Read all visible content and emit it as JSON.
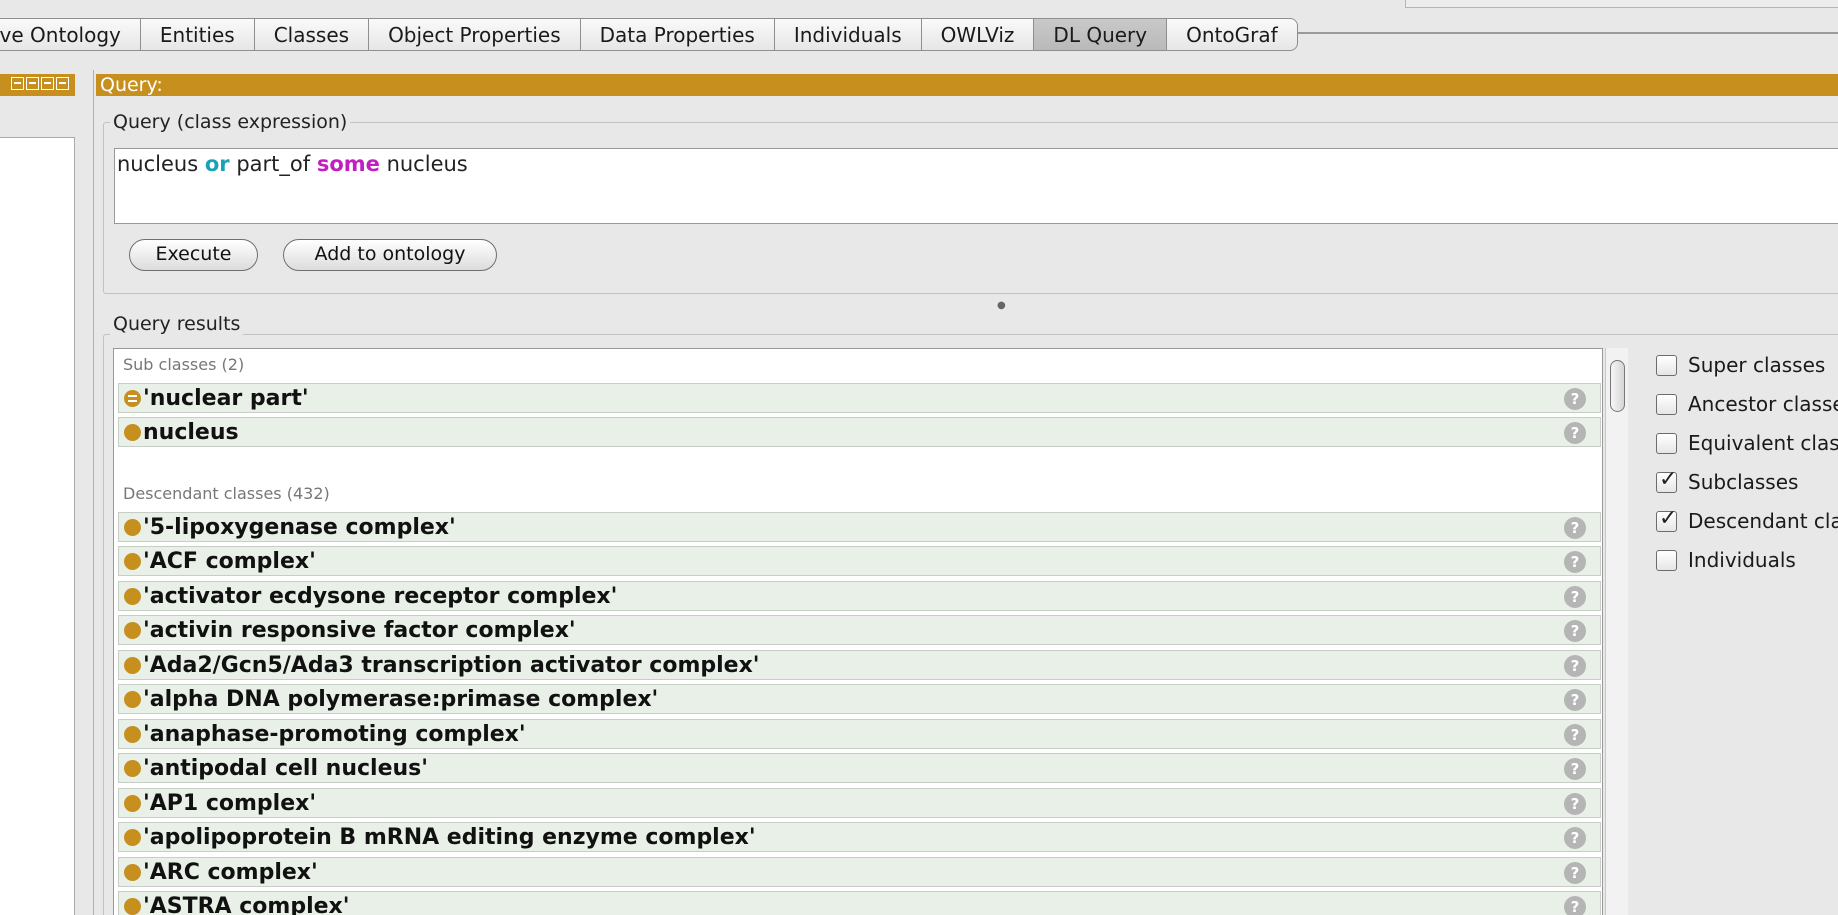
{
  "tabs": [
    {
      "label": "ive Ontology",
      "active": false
    },
    {
      "label": "Entities",
      "active": false
    },
    {
      "label": "Classes",
      "active": false
    },
    {
      "label": "Object Properties",
      "active": false
    },
    {
      "label": "Data Properties",
      "active": false
    },
    {
      "label": "Individuals",
      "active": false
    },
    {
      "label": "OWLViz",
      "active": false
    },
    {
      "label": "DL Query",
      "active": true
    },
    {
      "label": "OntoGraf",
      "active": false
    }
  ],
  "query_panel": {
    "header": "Query:",
    "expression_legend": "Query (class expression)",
    "expression": {
      "part1": "nucleus ",
      "kw1": "or",
      "part2": " part_of ",
      "kw2": "some",
      "part3": " nucleus"
    },
    "execute_label": "Execute",
    "add_label": "Add to ontology"
  },
  "results": {
    "legend": "Query results",
    "subclasses_label": "Sub classes (2)",
    "subclasses": [
      {
        "name": "'nuclear part'",
        "equivalent": true
      },
      {
        "name": "nucleus",
        "equivalent": false
      }
    ],
    "descendants_label": "Descendant classes (432)",
    "descendants": [
      "'5-lipoxygenase complex'",
      "'ACF complex'",
      "'activator ecdysone receptor complex'",
      "'activin responsive factor complex'",
      "'Ada2/Gcn5/Ada3 transcription activator complex'",
      "'alpha DNA polymerase:primase complex'",
      "'anaphase-promoting complex'",
      "'antipodal cell nucleus'",
      "'AP1 complex'",
      "'apolipoprotein B mRNA editing enzyme complex'",
      "'ARC complex'",
      "'ASTRA complex'"
    ],
    "help_glyph": "?"
  },
  "options": [
    {
      "label": "Super classes",
      "checked": false
    },
    {
      "label": "Ancestor classe",
      "checked": false
    },
    {
      "label": "Equivalent clas",
      "checked": false
    },
    {
      "label": "Subclasses",
      "checked": true
    },
    {
      "label": "Descendant cla",
      "checked": true
    },
    {
      "label": "Individuals",
      "checked": false
    }
  ],
  "colors": {
    "header_accent": "#c68f1e",
    "keyword_or": "#18a3b5",
    "keyword_some": "#c21fc0",
    "row_bg": "#e8f0e8"
  }
}
